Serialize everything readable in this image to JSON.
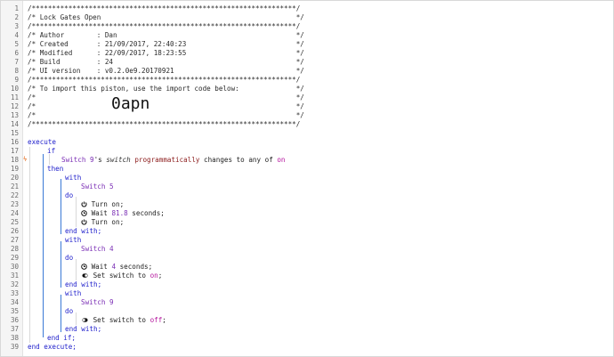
{
  "header": {
    "border": "/*****************************************************************/",
    "title": "/* Lock Gates Open                                                */",
    "author": "/* Author        : Dan                                            */",
    "created": "/* Created       : 21/09/2017, 22:40:23                           */",
    "modified": "/* Modified      : 22/09/2017, 18:23:55                           */",
    "build": "/* Build         : 24                                             */",
    "ui_version": "/* UI version    : v0.2.0e9.20170921                              */",
    "import_text": "/* To import this piston, use the import code below:              */",
    "blank": "/*                                                                */",
    "import_code": "0apn"
  },
  "line_numbers": [
    "1",
    "2",
    "3",
    "4",
    "5",
    "6",
    "7",
    "8",
    "9",
    "10",
    "11",
    "12",
    "13",
    "14",
    "15",
    "16",
    "17",
    "18",
    "19",
    "20",
    "21",
    "22",
    "23",
    "24",
    "25",
    "26",
    "27",
    "28",
    "29",
    "30",
    "31",
    "32",
    "33",
    "34",
    "35",
    "36",
    "37",
    "38",
    "39"
  ],
  "code": {
    "execute": "execute",
    "if": "if",
    "cond_device": "Switch 9",
    "cond_possessive": "'s ",
    "cond_attr": "switch",
    "cond_op": "programmatically",
    "cond_rest": " changes to any of ",
    "cond_val": "on",
    "then": "then",
    "with": "with",
    "do": "do",
    "end_with": "end with;",
    "end_if": "end if;",
    "end_execute": "end execute;",
    "dev1": "Switch 5",
    "turn_on": " Turn on;",
    "wait1_pre": " Wait ",
    "wait1_val": "81.8",
    "wait1_post": " seconds;",
    "dev2": "Switch 4",
    "wait2_val": "4",
    "set_pre": " Set switch to ",
    "set_val_on": "on",
    "set_val_off": "off",
    "semicolon": ";",
    "dev3": "Switch 9"
  },
  "colors": {
    "keyword": "#2222cc",
    "device": "#7b2fb5",
    "operator": "#8b1a1a",
    "value": "#b5179e"
  },
  "icons": {
    "power": "power-icon",
    "clock": "clock-icon",
    "toggle": "toggle-icon",
    "marker": "warning-marker-icon"
  }
}
